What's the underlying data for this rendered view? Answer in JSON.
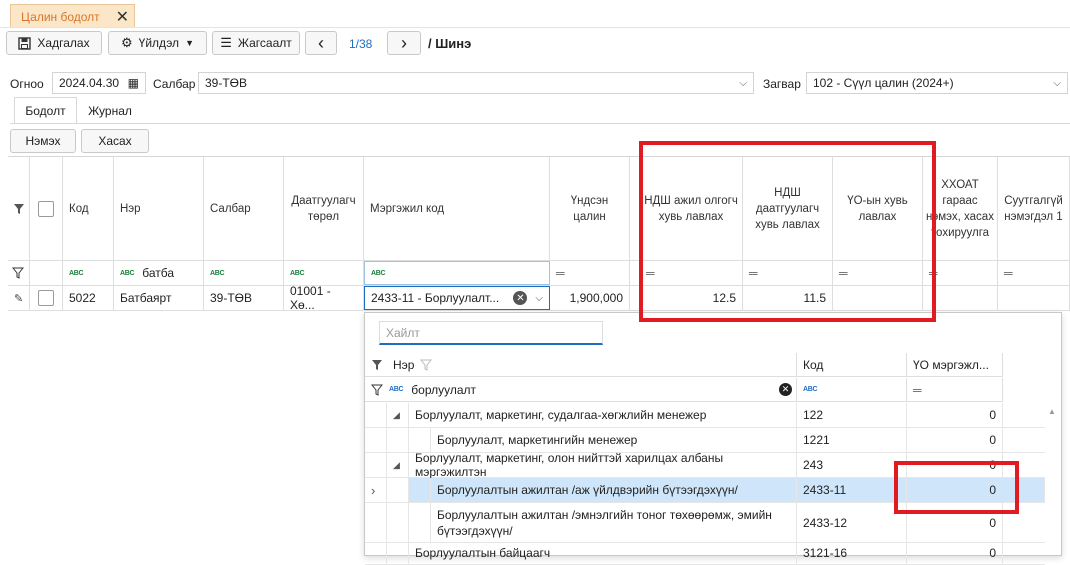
{
  "doc_tab": {
    "title": "Цалин бодолт",
    "close": "✕"
  },
  "toolbar": {
    "save_label": "Хадгалах",
    "actions_label": "Үйлдэл",
    "list_label": "Жагсаалт",
    "pager": "1/38",
    "title": "/ Шинэ"
  },
  "filters": {
    "date_label": "Огноо",
    "date_value": "2024.04.30",
    "branch_label": "Салбар",
    "branch_value": "39-ТӨВ",
    "template_label": "Загвар",
    "template_value": "102 - Сүүл цалин (2024+)"
  },
  "tabs": [
    "Бодолт",
    "Журнал"
  ],
  "grid_buttons": {
    "add": "Нэмэх",
    "remove": "Хасах"
  },
  "grid": {
    "columns": [
      "Код",
      "Нэр",
      "Салбар",
      "Даатгуулагч төрөл",
      "Мэргэжил код",
      "Үндсэн цалин",
      "НДШ ажил олгогч хувь лавлах",
      "НДШ даатгуулагч хувь лавлах",
      "ҮО-ын хувь лавлах",
      "ХХОАТ гараас нэмэх, хасах тохируулга",
      "Суутгалгүй нэмэгдэл 1"
    ],
    "filter_name_value": "батба",
    "row": {
      "code": "5022",
      "name": "Батбаярт",
      "branch": "39-ТӨВ",
      "insured_type": "01001 - Хө...",
      "profession": "2433-11 - Борлуулалт...",
      "salary": "1,900,000",
      "ndsh_employer": "12.5",
      "ndsh_insured": "11.5"
    }
  },
  "popup": {
    "search_placeholder": "Хайлт",
    "columns": [
      "Нэр",
      "Код",
      "ҮО мэргэжл..."
    ],
    "filter_value": "борлуулалт",
    "rows": [
      {
        "name": "Борлуулалт, маркетинг, судалгаа-хөгжлийн менежер",
        "code": "122",
        "value": "0",
        "level": 0
      },
      {
        "name": "Борлуулалт, маркетингийн менежер",
        "code": "1221",
        "value": "0",
        "level": 1
      },
      {
        "name": "Борлуулалт, маркетинг, олон нийттэй харилцах албаны мэргэжилтэн",
        "code": "243",
        "value": "0",
        "level": 0
      },
      {
        "name": "Борлуулалтын ажилтан /аж үйлдвэрийн бүтээгдэхүүн/",
        "code": "2433-11",
        "value": "0",
        "level": 1
      },
      {
        "name": "Борлуулалтын ажилтан /эмнэлгийн тоног төхөөрөмж, эмийн бүтээгдэхүүн/",
        "code": "2433-12",
        "value": "0",
        "level": 1
      },
      {
        "name": "Борлуулалтын байцаагч",
        "code": "3121-16",
        "value": "0",
        "level": 0
      }
    ]
  },
  "colors": {
    "highlight_box": "#e11b22",
    "selected_row": "#cfe6fa",
    "accent": "#1f6fc1"
  }
}
